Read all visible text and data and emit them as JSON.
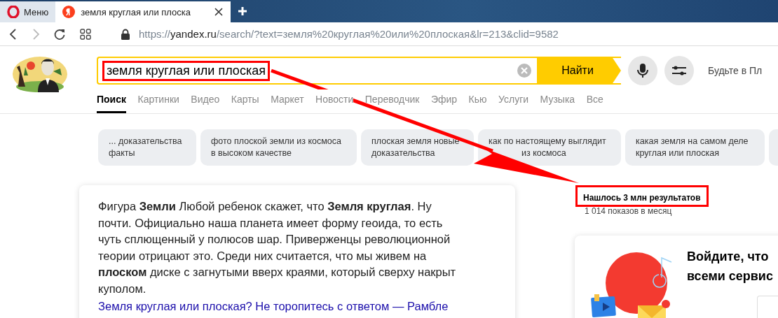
{
  "browser": {
    "tabs": [
      {
        "kind": "menu",
        "label": "Меню",
        "selected": false
      },
      {
        "kind": "page",
        "label": "земля круглая или плоска",
        "selected": true
      }
    ],
    "address": {
      "scheme": "https://",
      "host": "yandex.ru",
      "path": "/search/?text=земля%20круглая%20или%20плоская&lr=213&clid=9582"
    }
  },
  "search": {
    "query": "земля круглая или плоская",
    "button": "Найти"
  },
  "header_promo": "Будьте в Пл",
  "nav": [
    {
      "label": "Поиск",
      "selected": true
    },
    {
      "label": "Картинки",
      "selected": false
    },
    {
      "label": "Видео",
      "selected": false
    },
    {
      "label": "Карты",
      "selected": false
    },
    {
      "label": "Маркет",
      "selected": false
    },
    {
      "label": "Новости",
      "selected": false
    },
    {
      "label": "Переводчик",
      "selected": false
    },
    {
      "label": "Эфир",
      "selected": false
    },
    {
      "label": "Кью",
      "selected": false
    },
    {
      "label": "Услуги",
      "selected": false
    },
    {
      "label": "Музыка",
      "selected": false
    },
    {
      "label": "Все",
      "selected": false
    }
  ],
  "suggestions": [
    {
      "lines": [
        "... доказательства",
        "факты"
      ]
    },
    {
      "lines": [
        "фото плоской земли из космоса",
        "в высоком качестве"
      ]
    },
    {
      "lines": [
        "плоская земля новые",
        "доказательства"
      ]
    },
    {
      "lines": [
        "как по настоящему выглядит",
        "из космоса"
      ]
    },
    {
      "lines": [
        "какая земля на самом деле",
        "круглая или плоская"
      ]
    }
  ],
  "snippet": {
    "text": "Фигура **Земли** Любой ребенок скажет, что **Земля круглая**. Ну почти. Официально наша планета имеет форму геоида, то есть чуть сплющенный у полюсов шар. Приверженцы революционной теории отрицают это. Среди них считается, что мы живем на **плоском** диске с загнутыми вверх краями, который сверху накрыт куполом.",
    "link": "Земля круглая или плоская? Не торопитесь с ответом — Рамбле"
  },
  "stats": {
    "results": "Нашлось 3 млн результатов",
    "impressions": "1 014 показов в месяц"
  },
  "login_card": {
    "title_lines": [
      "Войдите, что",
      "всеми сервис"
    ]
  }
}
